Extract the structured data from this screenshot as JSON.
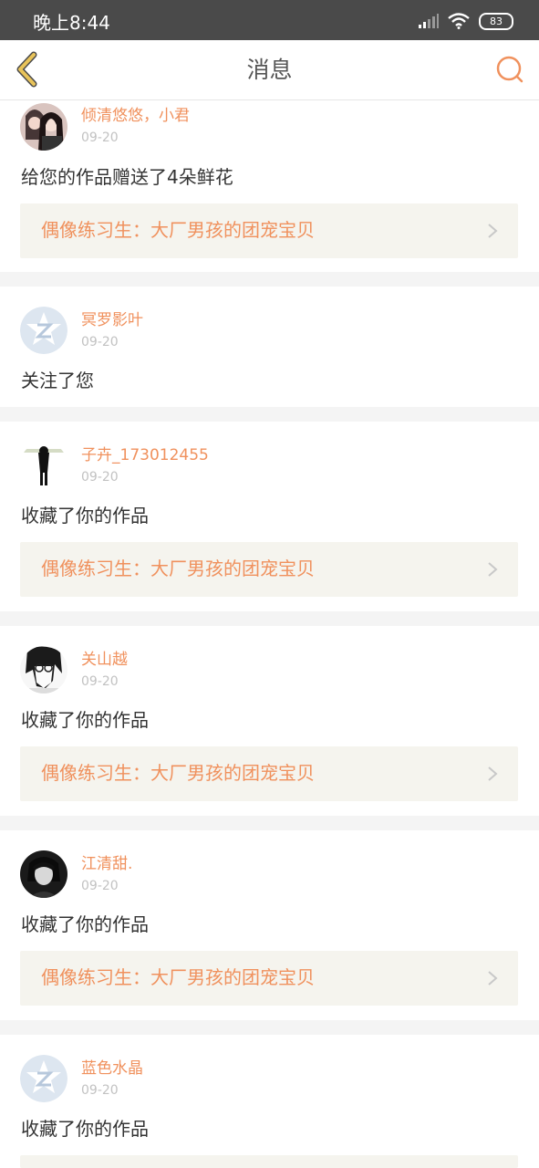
{
  "status_bar": {
    "time": "晚上8:44",
    "battery": "83",
    "icons": [
      "signal-icon",
      "wifi-icon",
      "battery-icon"
    ]
  },
  "header": {
    "title": "消息",
    "back_icon": "back-chevron-icon",
    "search_icon": "search-icon"
  },
  "colors": {
    "accent": "#f0915d",
    "back_icon": "#e8c35a",
    "link_bg": "#f5f4ee"
  },
  "messages": [
    {
      "user": "倾清悠悠，小君",
      "date": "09-20",
      "action": "给您的作品赠送了4朵鲜花",
      "work": "偶像练习生：大厂男孩的团宠宝贝"
    },
    {
      "user": "冥罗影叶",
      "date": "09-20",
      "action": "关注了您"
    },
    {
      "user": "子卉_173012455",
      "date": "09-20",
      "action": "收藏了你的作品",
      "work": "偶像练习生：大厂男孩的团宠宝贝"
    },
    {
      "user": "关山越",
      "date": "09-20",
      "action": "收藏了你的作品",
      "work": "偶像练习生：大厂男孩的团宠宝贝"
    },
    {
      "user": "江清甜.",
      "date": "09-20",
      "action": "收藏了你的作品",
      "work": "偶像练习生：大厂男孩的团宠宝贝"
    },
    {
      "user": "蓝色水晶",
      "date": "09-20",
      "action": "收藏了你的作品"
    }
  ]
}
